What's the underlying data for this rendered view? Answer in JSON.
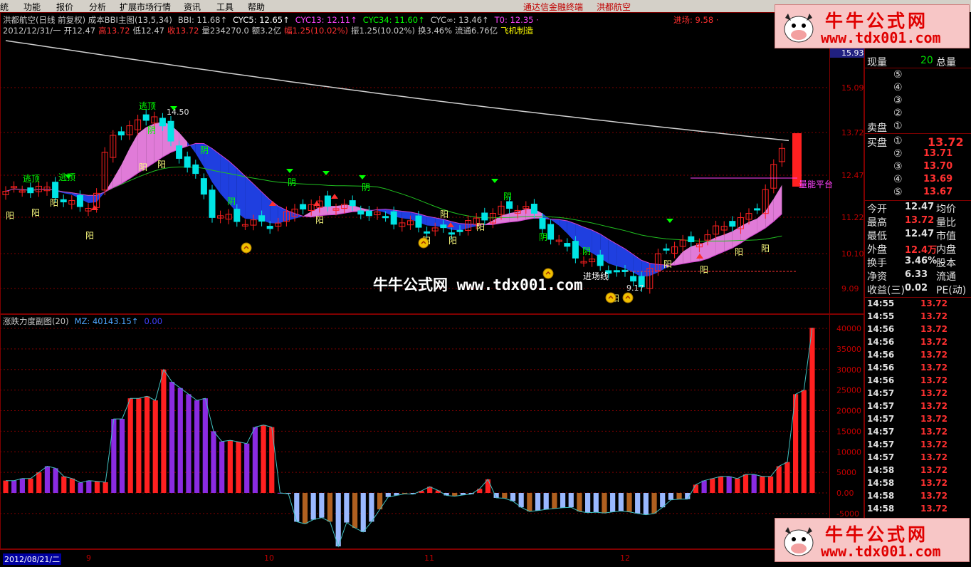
{
  "menu": {
    "items": [
      "统",
      "功能",
      "报价",
      "分析",
      "扩展市场行情",
      "资讯",
      "工具",
      "帮助"
    ],
    "title_left": "通达信金融终端",
    "title_right": "洪都航空"
  },
  "main_header": {
    "line1": [
      {
        "text": "洪都航空(日线 前复权) 成本BBI主图(13,5,34)",
        "color": "#c8c8c8"
      },
      {
        "text": "BBI: 11.68↑",
        "color": "#c8c8c8"
      },
      {
        "text": "CYC5: 12.65↑",
        "color": "#ffffff"
      },
      {
        "text": "CYC13: 12.11↑",
        "color": "#ff44ff"
      },
      {
        "text": "CYC34: 11.60↑",
        "color": "#00ff00"
      },
      {
        "text": "CYC∞: 13.46↑",
        "color": "#c8c8c8"
      },
      {
        "text": "T0: 12.35 ·",
        "color": "#ff44ff"
      },
      {
        "text": "进场: 9.58 ·",
        "color": "#ff3030"
      }
    ],
    "line2": [
      {
        "text": "2012/12/31/一",
        "color": "#c8c8c8"
      },
      {
        "text": "开12.47",
        "color": "#c8c8c8"
      },
      {
        "text": "高13.72",
        "color": "#ff3030"
      },
      {
        "text": "低12.47",
        "color": "#c8c8c8"
      },
      {
        "text": "收13.72",
        "color": "#ff3030"
      },
      {
        "text": "量234270.0",
        "color": "#c8c8c8"
      },
      {
        "text": "额3.2亿",
        "color": "#c8c8c8"
      },
      {
        "text": "幅1.25(10.02%)",
        "color": "#ff3030"
      },
      {
        "text": "振1.25(10.02%)",
        "color": "#c8c8c8"
      },
      {
        "text": "换3.46%",
        "color": "#c8c8c8"
      },
      {
        "text": "流通6.76亿",
        "color": "#c8c8c8"
      },
      {
        "text": "飞机制造",
        "color": "#ffff00"
      }
    ]
  },
  "price_axis": [
    "15.93",
    "15.09",
    "13.72",
    "12.47",
    "11.22",
    "10.10",
    "9.09"
  ],
  "chart_labels": {
    "escape_top": "逃顶",
    "yin": "阴",
    "yang": "阳",
    "high_mark": "14.50",
    "low_mark": "9.17",
    "entry_line": "进场线",
    "platform": "量能平台"
  },
  "sub_header": [
    {
      "text": "涨跌力度副图(20)",
      "color": "#c8c8c8"
    },
    {
      "text": "MZ: 40143.15↑",
      "color": "#4da6ff"
    },
    {
      "text": "0.00",
      "color": "#4040ff"
    }
  ],
  "sub_axis": [
    "40000",
    "35000",
    "30000",
    "25000",
    "20000",
    "15000",
    "10000",
    "5000",
    "0.00",
    "-5000"
  ],
  "time_axis": {
    "start": "2012/08/21/二",
    "months": [
      "9",
      "10",
      "11",
      "12"
    ]
  },
  "watermark": {
    "title": "牛牛公式网",
    "url": "www.tdx001.com",
    "center": "牛牛公式网 www.tdx001.com"
  },
  "quote": {
    "now_vol_label": "现量",
    "now_vol": "20",
    "total_vol_label": "总量",
    "sell_label": "卖盘",
    "buy_label": "买盘",
    "sell_levels": [
      "⑤",
      "④",
      "③",
      "②",
      "①"
    ],
    "buy_levels": [
      {
        "n": "①",
        "price": "13.72"
      },
      {
        "n": "②",
        "price": "13.71"
      },
      {
        "n": "③",
        "price": "13.70"
      },
      {
        "n": "④",
        "price": "13.69"
      },
      {
        "n": "⑤",
        "price": "13.67"
      }
    ],
    "stats": [
      {
        "l": "今开",
        "v": "12.47",
        "r": "均价",
        "vc": "#e0e0e0"
      },
      {
        "l": "最高",
        "v": "13.72",
        "r": "量比",
        "vc": "#ff3030"
      },
      {
        "l": "最低",
        "v": "12.47",
        "r": "市值",
        "vc": "#e0e0e0"
      },
      {
        "l": "外盘",
        "v": "12.4万",
        "r": "内盘",
        "vc": "#ff3030"
      },
      {
        "l": "换手",
        "v": "3.46%",
        "r": "股本",
        "vc": "#e0e0e0"
      },
      {
        "l": "净资",
        "v": "6.33",
        "r": "流通",
        "vc": "#e0e0e0"
      },
      {
        "l": "收益(三)",
        "v": "0.02",
        "r": "PE(动)",
        "vc": "#e0e0e0"
      }
    ],
    "ticks": [
      {
        "t": "14:55",
        "p": "13.72"
      },
      {
        "t": "14:55",
        "p": "13.72"
      },
      {
        "t": "14:56",
        "p": "13.72"
      },
      {
        "t": "14:56",
        "p": "13.72"
      },
      {
        "t": "14:56",
        "p": "13.72"
      },
      {
        "t": "14:56",
        "p": "13.72"
      },
      {
        "t": "14:56",
        "p": "13.72"
      },
      {
        "t": "14:57",
        "p": "13.72"
      },
      {
        "t": "14:57",
        "p": "13.72"
      },
      {
        "t": "14:57",
        "p": "13.72"
      },
      {
        "t": "14:57",
        "p": "13.72"
      },
      {
        "t": "14:57",
        "p": "13.72"
      },
      {
        "t": "14:57",
        "p": "13.72"
      },
      {
        "t": "14:58",
        "p": "13.72"
      },
      {
        "t": "14:58",
        "p": "13.72"
      },
      {
        "t": "14:58",
        "p": "13.72"
      },
      {
        "t": "14:58",
        "p": "13.72"
      }
    ]
  },
  "colors": {
    "up": "#ff2020",
    "down": "#00e5e5",
    "grid": "#800000",
    "purple": "#8a2be2",
    "ltblue": "#9ab8ff",
    "brown": "#b06020",
    "pink": "#e07bd8",
    "blue": "#1f3fe0"
  },
  "chart_data": {
    "type": "bar",
    "title": "涨跌力度副图(20)",
    "ylim": [
      -5000,
      40000
    ],
    "series_note": "",
    "values": [
      3000,
      3000,
      3500,
      3500,
      5000,
      6500,
      6000,
      4000,
      3500,
      2500,
      3000,
      2800,
      2600,
      18000,
      18000,
      23000,
      23000,
      23500,
      22500,
      30000,
      27000,
      25500,
      24000,
      22500,
      23000,
      15000,
      12500,
      12800,
      12400,
      12000,
      16000,
      16500,
      16000,
      0,
      -200,
      -7000,
      -7500,
      -6500,
      -6000,
      -7000,
      -13000,
      -7200,
      -8500,
      -9500,
      -7000,
      -4000,
      -1000,
      -600,
      -200,
      -300,
      500,
      1500,
      600,
      -600,
      -800,
      -500,
      -300,
      1000,
      3300,
      -1200,
      -1300,
      -2000,
      -3500,
      -4500,
      -4300,
      -4000,
      -3800,
      -3600,
      -3500,
      -4500,
      -4800,
      -4700,
      -4900,
      -4600,
      -4400,
      -4600,
      -5000,
      -5300,
      -5000,
      -3500,
      -1700,
      -1500,
      -1500,
      2000,
      3000,
      3500,
      4000,
      4000,
      3500,
      4500,
      4500,
      4000,
      4000,
      6500,
      7500,
      24000,
      25000,
      40143
    ]
  }
}
